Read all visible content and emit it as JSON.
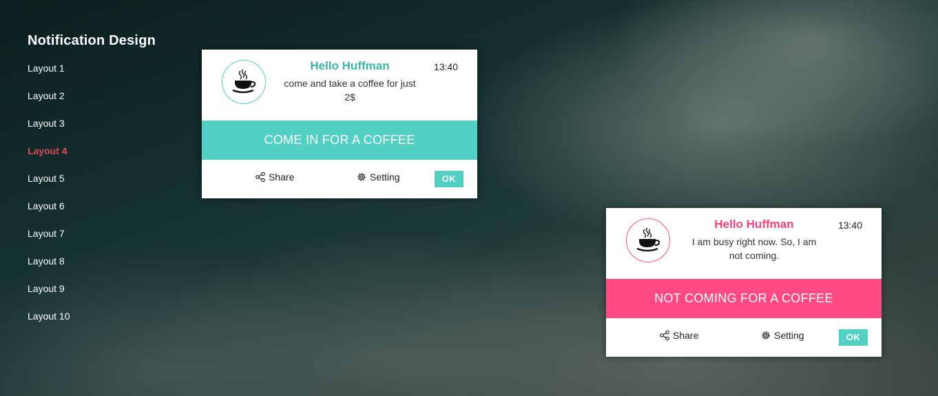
{
  "sidebar": {
    "title": "Notification Design",
    "items": [
      {
        "label": "Layout 1"
      },
      {
        "label": "Layout 2"
      },
      {
        "label": "Layout 3"
      },
      {
        "label": "Layout 4",
        "active": true
      },
      {
        "label": "Layout 5"
      },
      {
        "label": "Layout 6"
      },
      {
        "label": "Layout 7"
      },
      {
        "label": "Layout 8"
      },
      {
        "label": "Layout 9"
      },
      {
        "label": "Layout 10"
      }
    ],
    "active_color": "#e04a58"
  },
  "notifications": [
    {
      "theme": "teal",
      "icon": "coffee-cup-icon",
      "sender": "Hello Huffman",
      "message": "come and take a coffee for just 2$",
      "time": "13:40",
      "banner": "COME IN FOR A COFFEE",
      "share_label": "Share",
      "setting_label": "Setting",
      "ok_label": "OK",
      "accent_color": "#52d0c4"
    },
    {
      "theme": "pink",
      "icon": "coffee-cup-icon",
      "sender": "Hello Huffman",
      "message": "I am busy right now. So, I am not coming.",
      "time": "13:40",
      "banner": "NOT COMING FOR A COFFEE",
      "share_label": "Share",
      "setting_label": "Setting",
      "ok_label": "OK",
      "accent_color": "#ff4a83"
    }
  ]
}
